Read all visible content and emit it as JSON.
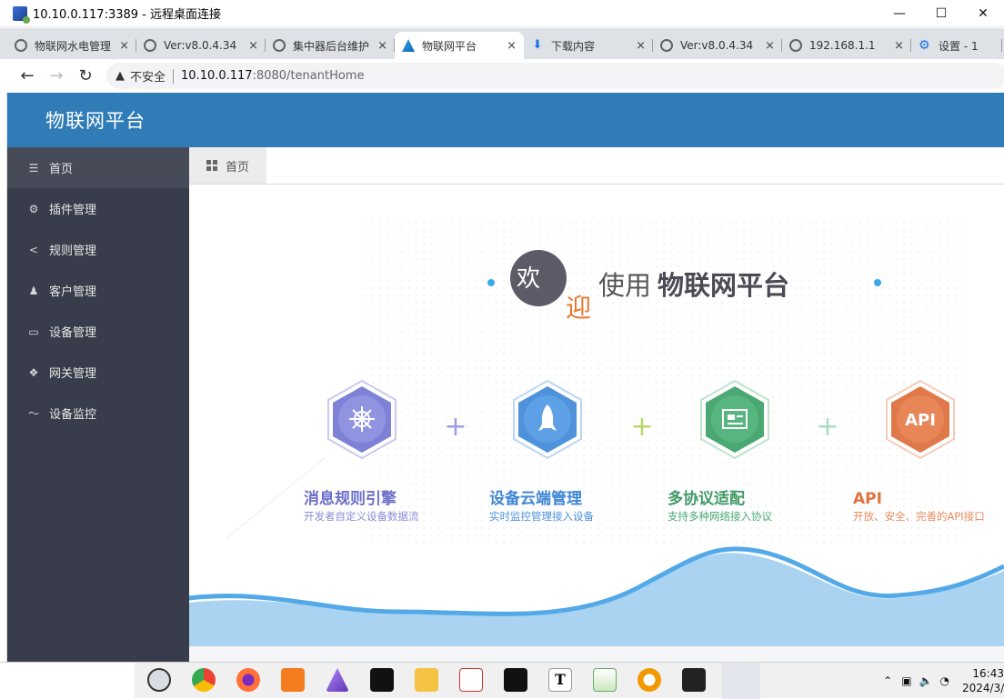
{
  "rdp": {
    "title": "10.10.0.117:3389 - 远程桌面连接",
    "minimize": "—",
    "maximize": "☐",
    "close": "✕"
  },
  "browser": {
    "tabs": [
      {
        "label": "物联网水电管理",
        "icon": "globe-icon"
      },
      {
        "label": "Ver:v8.0.4.34",
        "icon": "globe-icon"
      },
      {
        "label": "集中器后台维护",
        "icon": "globe-icon"
      },
      {
        "label": "物联网平台",
        "icon": "iot-logo-icon"
      },
      {
        "label": "下载内容",
        "icon": "download-icon"
      },
      {
        "label": "Ver:v8.0.4.34",
        "icon": "globe-icon"
      },
      {
        "label": "192.168.1.1",
        "icon": "globe-icon"
      },
      {
        "label": "设置 - 1",
        "icon": "gear-icon"
      }
    ],
    "tab_close": "×",
    "insecure_label": "不安全",
    "url_host": "10.10.0.117",
    "url_path": ":8080/tenantHome"
  },
  "app": {
    "title": "物联网平台",
    "menu": [
      {
        "label": "首页",
        "icon": "menu-icon"
      },
      {
        "label": "插件管理",
        "icon": "plugin-icon"
      },
      {
        "label": "规则管理",
        "icon": "share-icon"
      },
      {
        "label": "客户管理",
        "icon": "user-icon"
      },
      {
        "label": "设备管理",
        "icon": "monitor-icon"
      },
      {
        "label": "网关管理",
        "icon": "cubes-icon"
      },
      {
        "label": "设备监控",
        "icon": "pulse-icon"
      }
    ],
    "content_tab": "首页"
  },
  "banner": {
    "welcome_1": "欢",
    "welcome_2": "迎",
    "welcome_text_light": "使用",
    "welcome_text_bold": "物联网平台",
    "plus": "+",
    "features": [
      {
        "title": "消息规则引擎",
        "desc": "开发者自定义设备数据流",
        "color": "#7a7fd6",
        "icon": "helm-icon"
      },
      {
        "title": "设备云端管理",
        "desc": "实时监控管理接入设备",
        "color": "#4a8fd8",
        "icon": "rocket-icon"
      },
      {
        "title": "多协议适配",
        "desc": "支持多种网络接入协议",
        "color": "#47a86f",
        "icon": "device-icon"
      },
      {
        "title": "API",
        "desc": "开放、安全、完善的API接口",
        "color": "#e0794a",
        "icon": "api-icon"
      }
    ],
    "api_badge": "API"
  },
  "taskbar": {
    "time": "16:43",
    "date": "2024/3/"
  }
}
